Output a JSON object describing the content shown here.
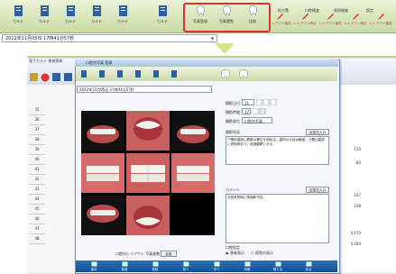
{
  "top_toolbar": {
    "buttons": [
      {
        "label": "カルテ",
        "icon": "document-icon"
      },
      {
        "label": "カルテ",
        "icon": "document-icon"
      },
      {
        "label": "カルテ",
        "icon": "document-icon"
      },
      {
        "label": "カルテ",
        "icon": "document-icon"
      },
      {
        "label": "カルテ",
        "icon": "document-icon"
      },
      {
        "label": "カルテ",
        "icon": "document-icon"
      }
    ],
    "highlighted": [
      {
        "label": "写真登録",
        "icon": "tooth-icon"
      },
      {
        "label": "写真閲覧",
        "icon": "tooth-icon"
      },
      {
        "label": "比較",
        "icon": "tooth-icon"
      }
    ],
    "right_buttons": [
      {
        "label": "処方箋",
        "icon": "tooth-icon"
      },
      {
        "label": "口腔検査",
        "icon": "tooth-icon"
      },
      {
        "label": "歯周検査",
        "icon": "tooth-icon"
      },
      {
        "label": "設定",
        "icon": "tooth-icon"
      },
      {
        "label": "レイアウト",
        "icon": "tooth-icon"
      }
    ],
    "small_labels": [
      "レイアウト保存",
      "レイアウト読込",
      "レイアウト保存",
      "レイアウト読込",
      "レイアウト保存",
      "レイアウト"
    ],
    "date_select": "2012年11月05日 17時41分57秒"
  },
  "background_app": {
    "title": "電子カルテ  患者情報",
    "row_numbers": [
      "35",
      "36",
      "37",
      "38",
      "39",
      "40",
      "41",
      "42",
      "43",
      "44",
      "45",
      "46",
      "47",
      "48"
    ],
    "right_values": [
      "110",
      "80",
      "147",
      "148",
      "4,170",
      "4,184"
    ]
  },
  "dialog": {
    "title": "口腔内写真 登録",
    "date_select": "2012年11月05日 17時41分57秒",
    "fields": {
      "date_label": "撮影日付",
      "date_value": "11",
      "time_label": "撮影時間",
      "time_value": "17",
      "item_label": "撮影部位",
      "item_value": "口腔内写真",
      "memo_label": "撮影所見",
      "memo_text": "下顎前歯部に軽度の叢生を認める。歯肉の炎症は軽度。上顎臼歯部に修復物あり。経過観察とする。",
      "template_button": "定型文入力",
      "comment_label": "コメント",
      "comment_text": "次回来院時に再撮影予定。",
      "template_button2": "定型文入力",
      "setting_label": "口腔設定",
      "option1": "患者表示",
      "option2": "医院内表示",
      "photo_caption": "口腔内レイアウト 写真枚数",
      "layout_button": "変更"
    },
    "bottom_buttons": [
      "保存",
      "新規",
      "削除",
      "前へ",
      "次へ",
      "印刷",
      "閉じる",
      "戻る"
    ]
  },
  "colors": {
    "highlight_red": "#e0312e",
    "toolbar_green": "#c9dba6",
    "bottom_blue": "#154f93"
  }
}
